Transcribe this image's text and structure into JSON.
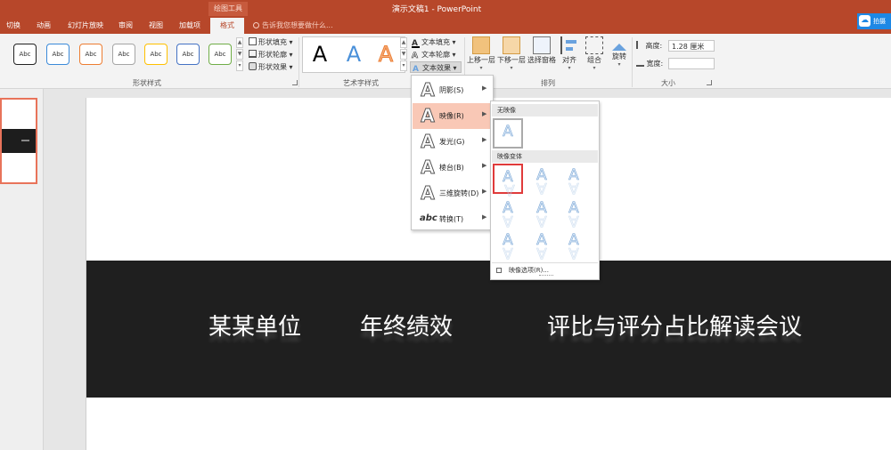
{
  "title_bar": {
    "tool_group": "绘图工具",
    "title": "演示文稿1 - PowerPoint",
    "share_label": "拍摄"
  },
  "tabs": [
    "切换",
    "动画",
    "幻灯片放映",
    "审阅",
    "视图",
    "加载项",
    "格式"
  ],
  "tell_me": "告诉我您想要做什么...",
  "ribbon": {
    "shape_styles": {
      "sample_label": "Abc",
      "fill": "形状填充",
      "outline": "形状轮廓",
      "effects": "形状效果",
      "group_label": "形状样式"
    },
    "wordart_styles": {
      "sample": "A",
      "text_fill": "文本填充",
      "text_outline": "文本轮廓",
      "text_effects": "文本效果",
      "group_label": "艺术字样式"
    },
    "arrange": {
      "bring_forward": "上移一层",
      "send_backward": "下移一层",
      "selection_pane": "选择窗格",
      "align": "对齐",
      "group": "组合",
      "rotate": "旋转",
      "group_label": "排列"
    },
    "size": {
      "height_label": "高度:",
      "height_value": "1.28 厘米",
      "width_label": "宽度:",
      "width_value": "",
      "group_label": "大小"
    }
  },
  "effects_menu": [
    {
      "label": "阴影(S)",
      "icon": "A"
    },
    {
      "label": "映像(R)",
      "icon": "A"
    },
    {
      "label": "发光(G)",
      "icon": "A"
    },
    {
      "label": "棱台(B)",
      "icon": "A"
    },
    {
      "label": "三维旋转(D)",
      "icon": "A"
    },
    {
      "label": "转换(T)",
      "icon": "abc"
    }
  ],
  "reflection_menu": {
    "no_reflection_header": "无映像",
    "variants_header": "映像变体",
    "tile_glyph": "A",
    "options": "映像选项(R)..."
  },
  "slide": {
    "text1": "某某单位",
    "text2": "年终绩效",
    "text3": "评比与评分占比解读会议"
  },
  "colors": {
    "accent": "#b7472a",
    "selection_highlight": "#f9c8b6",
    "selected_border": "#e03b3b"
  }
}
